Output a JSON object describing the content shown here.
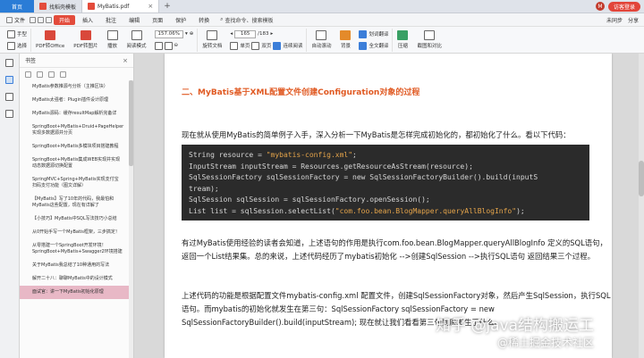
{
  "tabs": {
    "home": "首页",
    "items": [
      {
        "label": "找稻壳模板",
        "color": "#e34b3b",
        "active": false
      },
      {
        "label": "MyBatis.pdf",
        "color": "#e34b3b",
        "active": true
      }
    ],
    "add": "+",
    "close": "×",
    "user_initial": "M",
    "login": "访客登录"
  },
  "menu": {
    "file": "文件",
    "items": [
      "开始",
      "插入",
      "批注",
      "编辑",
      "页面",
      "保护",
      "转换"
    ],
    "active_index": 0,
    "search": "查找命令、搜索模板",
    "right": [
      "未同步",
      "分享"
    ]
  },
  "toolbar": {
    "hand": "手型",
    "select": "选择",
    "pdf_to_office": "PDF转Office",
    "pdf_to_image": "PDF转图片",
    "play": "播放",
    "read_mode": "阅读模式",
    "zoom": "157.06%",
    "rotate": "旋转文档",
    "page_current": "165",
    "page_total": "/183",
    "single": "单页",
    "double": "双页",
    "continuous": "连续阅读",
    "auto_scroll": "自动滚动",
    "background": "背景",
    "translate_word": "划词翻译",
    "translate_full": "全文翻译",
    "compress": "压缩",
    "screenshot_compare": "截图和对比"
  },
  "rail": {
    "icons": [
      "thumbnail-icon",
      "bookmark-icon",
      "annotation-icon",
      "search-icon"
    ]
  },
  "bookmarks": {
    "title": "书签",
    "close": "×",
    "items": [
      "MyBatis参数推源与分析（主推区块）",
      "MyBatis太强者：Plugin插件设计原理",
      "MyBatis源码：缓存resultMap解析完备详",
      "SpringBoot+MyBatis+Druid+PageHelper实现多数据源并分页",
      "SpringBoot+MyBatis多模块项目搭建教程",
      "SpringBoot+MyBatis集成WEB实现并实现动态数据源切换配置",
      "SpringMVC+Spring+MyBatis实现支付宝扫码支付功能（图文详解）",
      "【MyBatis】写了10年的代码，我最怕和MyBatis这些配置，现在有详解了",
      "【小技巧】MyBatis中SQL写法技巧小总结",
      "从0开始手写一个MyBatis框架，三步搞定！",
      "从零搭建一个SpringBoot开发环境！SpringBoot+MyBatis+Swagger2环境搭建",
      "关于MyBatis我总结了10种通用的写法",
      "解开二十八：聊聊MyBatis中的设计模式",
      "面试官：讲一下MyBatis初始化原理"
    ],
    "selected_index": 13
  },
  "document": {
    "heading": "二、MyBatis基于XML配置文件创建Configuration对象的过程",
    "intro": "现在就从使用MyBatis的简单例子入手，深入分析一下MyBatis是怎样完成初始化的，都初始化了什么。看以下代码：",
    "code": {
      "l1_a": "String resource = ",
      "l1_str": "\"mybatis-config.xml\"",
      "l1_b": ";",
      "l2": "InputStream inputStream = Resources.getResourceAsStream(resource);",
      "l3": "SqlSessionFactory sqlSessionFactory = new SqlSessionFactoryBuilder().build(inputS",
      "l4": "tream);",
      "l5": "SqlSession sqlSession = sqlSessionFactory.openSession();",
      "l6_a": "List list = sqlSession.selectList(",
      "l6_str": "\"com.foo.bean.BlogMapper.queryAllBlogInfo\"",
      "l6_b": ");"
    },
    "para2": "有过MyBatis使用经验的读者会知道，上述语句的作用是执行com.foo.bean.BlogMapper.queryAllBlogInfo   定义的SQL语句，返回一个List结果集。总的来说，上述代码经历了mybatis初始化 -->创建SqlSession -->执行SQL语句 返回结果三个过程。",
    "para3": "上述代码的功能是根据配置文件mybatis-config.xml   配置文件，创建SqlSessionFactory对象，然后产生SqlSession，执行SQL语句。而mybatis的初始化就发生在第三句：SqlSessionFactory     sqlSessionFactory     =     new SqlSessionFactoryBuilder().build(inputStream); 现在就让我们看看第三句到底发生了什么。",
    "watermark": "知乎 @java结构搬运工",
    "watermark_sub": "@稀土掘金技术社区"
  }
}
